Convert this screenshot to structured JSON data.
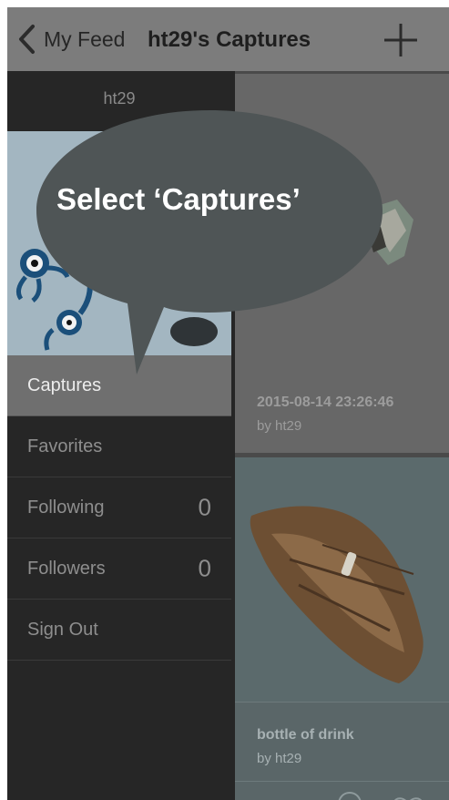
{
  "nav": {
    "back_label": "My Feed",
    "title": "ht29's Captures"
  },
  "sidebar": {
    "username": "ht29",
    "menu": [
      {
        "label": "Captures",
        "active": true
      },
      {
        "label": "Favorites"
      },
      {
        "label": "Following",
        "count": "0"
      },
      {
        "label": "Followers",
        "count": "0"
      },
      {
        "label": "Sign Out"
      }
    ]
  },
  "feed": {
    "cards": [
      {
        "title": "2015-08-14 23:26:46",
        "author": "by ht29"
      },
      {
        "title": "bottle of drink",
        "author": "by ht29"
      }
    ]
  },
  "callout": {
    "text": "Select ‘Captures’"
  },
  "colors": {
    "navbar": "#7c7c7c",
    "sidebar": "#262626",
    "active_item": "#6f6f6f",
    "callout": "#4f5556"
  }
}
